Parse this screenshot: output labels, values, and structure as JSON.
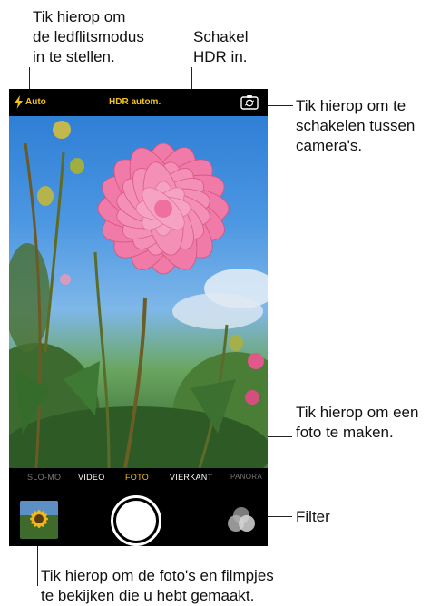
{
  "callouts": {
    "flash": [
      "Tik hierop om",
      "de ledflitsmodus",
      "in te stellen."
    ],
    "hdr": [
      "Schakel",
      "HDR in."
    ],
    "switch": [
      "Tik hierop om te",
      "schakelen tussen",
      "camera's."
    ],
    "shutter": [
      "Tik hierop om een",
      "foto te maken."
    ],
    "filter": "Filter",
    "thumbnail": [
      "Tik hierop om de foto's en filmpjes",
      "te bekijken die u hebt gemaakt."
    ]
  },
  "topbar": {
    "flash_label": "Auto",
    "hdr_label": "HDR autom."
  },
  "modes": {
    "slomo": "SLO-MO",
    "video": "VIDEO",
    "foto": "FOTO",
    "vierkant": "VIERKANT",
    "panorama": "PANORA"
  },
  "colors": {
    "accent": "#f3c21a",
    "flower": "#f07aa8",
    "sky": "#3f8ee0"
  },
  "icons": {
    "flash": "lightning-bolt",
    "switch": "camera-rotate",
    "filter": "three-circles"
  }
}
